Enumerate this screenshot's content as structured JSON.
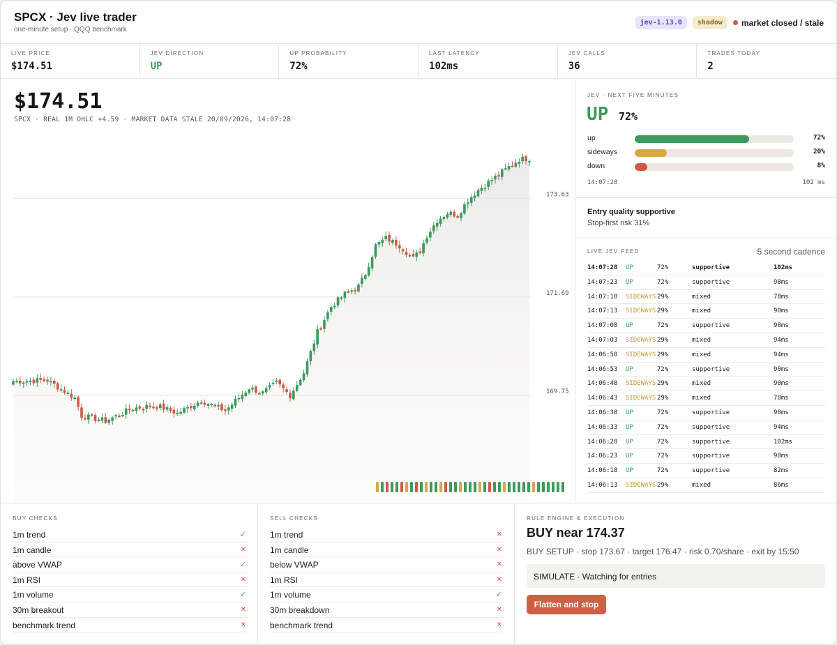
{
  "header": {
    "title": "SPCX · Jev live trader",
    "subtitle": "one-minute setup · QQQ benchmark",
    "version_badge": "jev-1.13.0",
    "mode_badge": "shadow",
    "status": "market closed / stale",
    "status_color": "#cf5a43"
  },
  "stats": [
    {
      "label": "LIVE PRICE",
      "value": "$174.51"
    },
    {
      "label": "JEV DIRECTION",
      "value": "UP"
    },
    {
      "label": "UP PROBABILITY",
      "value": "72%"
    },
    {
      "label": "LAST LATENCY",
      "value": "102ms"
    },
    {
      "label": "JEV CALLS",
      "value": "36"
    },
    {
      "label": "TRADES TODAY",
      "value": "2"
    }
  ],
  "price_panel": {
    "price": "$174.51",
    "meta": "SPCX · REAL 1M OHLC  +4.59 · MARKET DATA STALE  20/09/2026, 14:07:28"
  },
  "forecast": {
    "label": "JEV · NEXT FIVE MINUTES",
    "direction": "UP",
    "direction_prob": "72%",
    "rows": [
      {
        "name": "up",
        "value": "72%",
        "fraction": 0.72,
        "color": "#3d9a5c"
      },
      {
        "name": "sideways",
        "value": "20%",
        "fraction": 0.2,
        "color": "#d6a84a"
      },
      {
        "name": "down",
        "value": "8%",
        "fraction": 0.08,
        "color": "#cf5a43"
      }
    ],
    "time": "14:07:28",
    "latency": "102 ms"
  },
  "quality": {
    "title": "Entry quality supportive",
    "subtitle": "Stop-first risk 31%"
  },
  "feed": {
    "label": "LIVE JEV FEED",
    "cadence": "5 second cadence",
    "rows": [
      {
        "time": "14:07:28",
        "dir": "UP",
        "prob": "72%",
        "quality": "supportive",
        "latency": "102ms"
      },
      {
        "time": "14:07:23",
        "dir": "UP",
        "prob": "72%",
        "quality": "supportive",
        "latency": "98ms"
      },
      {
        "time": "14:07:18",
        "dir": "SIDEWAYS",
        "prob": "29%",
        "quality": "mixed",
        "latency": "78ms"
      },
      {
        "time": "14:07:13",
        "dir": "SIDEWAYS",
        "prob": "29%",
        "quality": "mixed",
        "latency": "90ms"
      },
      {
        "time": "14:07:08",
        "dir": "UP",
        "prob": "72%",
        "quality": "supportive",
        "latency": "98ms"
      },
      {
        "time": "14:07:03",
        "dir": "SIDEWAYS",
        "prob": "29%",
        "quality": "mixed",
        "latency": "94ms"
      },
      {
        "time": "14:06:58",
        "dir": "SIDEWAYS",
        "prob": "29%",
        "quality": "mixed",
        "latency": "94ms"
      },
      {
        "time": "14:06:53",
        "dir": "UP",
        "prob": "72%",
        "quality": "supportive",
        "latency": "90ms"
      },
      {
        "time": "14:06:48",
        "dir": "SIDEWAYS",
        "prob": "29%",
        "quality": "mixed",
        "latency": "90ms"
      },
      {
        "time": "14:06:43",
        "dir": "SIDEWAYS",
        "prob": "29%",
        "quality": "mixed",
        "latency": "78ms"
      },
      {
        "time": "14:06:38",
        "dir": "UP",
        "prob": "72%",
        "quality": "supportive",
        "latency": "98ms"
      },
      {
        "time": "14:06:33",
        "dir": "UP",
        "prob": "72%",
        "quality": "supportive",
        "latency": "94ms"
      },
      {
        "time": "14:06:28",
        "dir": "UP",
        "prob": "72%",
        "quality": "supportive",
        "latency": "102ms"
      },
      {
        "time": "14:06:23",
        "dir": "UP",
        "prob": "72%",
        "quality": "supportive",
        "latency": "98ms"
      },
      {
        "time": "14:06:18",
        "dir": "UP",
        "prob": "72%",
        "quality": "supportive",
        "latency": "82ms"
      },
      {
        "time": "14:06:13",
        "dir": "SIDEWAYS",
        "prob": "29%",
        "quality": "mixed",
        "latency": "86ms"
      }
    ]
  },
  "buy_checks": {
    "label": "BUY CHECKS",
    "items": [
      {
        "name": "1m trend",
        "pass": true
      },
      {
        "name": "1m candle",
        "pass": false
      },
      {
        "name": "above VWAP",
        "pass": true
      },
      {
        "name": "1m RSI",
        "pass": false
      },
      {
        "name": "1m volume",
        "pass": true
      },
      {
        "name": "30m breakout",
        "pass": false
      },
      {
        "name": "benchmark trend",
        "pass": false
      }
    ]
  },
  "sell_checks": {
    "label": "SELL CHECKS",
    "items": [
      {
        "name": "1m trend",
        "pass": false
      },
      {
        "name": "1m candle",
        "pass": false
      },
      {
        "name": "below VWAP",
        "pass": false
      },
      {
        "name": "1m RSI",
        "pass": false
      },
      {
        "name": "1m volume",
        "pass": true
      },
      {
        "name": "30m breakdown",
        "pass": false
      },
      {
        "name": "benchmark trend",
        "pass": false
      }
    ]
  },
  "engine": {
    "label": "RULE ENGINE & EXECUTION",
    "title": "BUY near 174.37",
    "subtitle": "BUY SETUP · stop 173.67 · target 176.47 · risk 0.70/share · exit by 15:50",
    "status_box": "SIMULATE · Watching for entries",
    "flatten_button": "Flatten and stop"
  },
  "chart_data": {
    "type": "candlestick",
    "title": "",
    "xlabel": "",
    "ylabel": "",
    "y_ticks": [
      169.75,
      171.69,
      173.63
    ],
    "ylim": [
      168.9,
      174.6
    ],
    "up_color": "#3d9a5c",
    "down_color": "#cf5a43",
    "anchors": [
      [
        0,
        170.03
      ],
      [
        10,
        170.05
      ],
      [
        18,
        169.7
      ],
      [
        20,
        169.35
      ],
      [
        27,
        169.25
      ],
      [
        35,
        169.5
      ],
      [
        42,
        169.55
      ],
      [
        48,
        169.4
      ],
      [
        55,
        169.65
      ],
      [
        62,
        169.45
      ],
      [
        69,
        169.9
      ],
      [
        73,
        169.8
      ],
      [
        77,
        170.0
      ],
      [
        81,
        169.75
      ],
      [
        85,
        170.2
      ],
      [
        89,
        171.0
      ],
      [
        93,
        171.5
      ],
      [
        97,
        171.75
      ],
      [
        101,
        171.9
      ],
      [
        103,
        172.15
      ],
      [
        106,
        172.7
      ],
      [
        109,
        172.85
      ],
      [
        113,
        172.7
      ],
      [
        117,
        172.45
      ],
      [
        119,
        172.6
      ],
      [
        121,
        172.9
      ],
      [
        124,
        173.2
      ],
      [
        127,
        173.35
      ],
      [
        130,
        173.3
      ],
      [
        133,
        173.6
      ],
      [
        136,
        173.8
      ],
      [
        140,
        174.0
      ],
      [
        144,
        174.2
      ],
      [
        148,
        174.4
      ],
      [
        151,
        174.42
      ]
    ],
    "volume_highlights": [
      [
        75,
        100
      ],
      [
        115,
        125
      ]
    ],
    "signal_strip": [
      "#d6a84a",
      "#3d9a5c",
      "#cf5a43",
      "#3d9a5c",
      "#3d9a5c",
      "#cf5a43",
      "#d6a84a",
      "#3d9a5c",
      "#cf5a43",
      "#3d9a5c",
      "#d6a84a",
      "#3d9a5c",
      "#3d9a5c",
      "#d6a84a",
      "#cf5a43",
      "#3d9a5c",
      "#3d9a5c",
      "#d6a84a",
      "#3d9a5c",
      "#3d9a5c",
      "#3d9a5c",
      "#d6a84a",
      "#3d9a5c",
      "#cf5a43",
      "#3d9a5c",
      "#3d9a5c",
      "#d6a84a",
      "#3d9a5c",
      "#3d9a5c",
      "#3d9a5c",
      "#3d9a5c",
      "#3d9a5c",
      "#d6a84a",
      "#3d9a5c",
      "#3d9a5c",
      "#3d9a5c",
      "#3d9a5c",
      "#3d9a5c",
      "#3d9a5c"
    ]
  }
}
